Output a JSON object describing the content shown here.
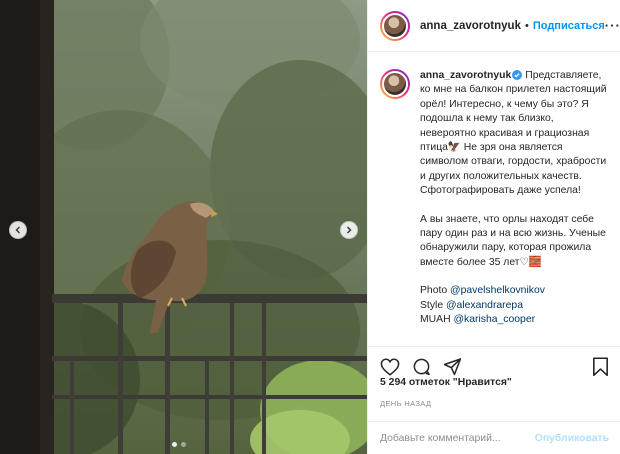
{
  "post": {
    "author": "anna_zavorotnyuk",
    "follow_label": "Подписаться",
    "separator": "•",
    "more_label": "···"
  },
  "caption": {
    "username": "anna_zavorotnyuk",
    "paragraph1": "Представляете, ко мне на балкон прилетел настоящий орёл! Интересно, к чему бы это? Я подошла к нему так близко, невероятно красивая и грациозная птица🦅 Не зря она является символом отваги, гордости, храбрости и других положительных качеств. Сфотографировать даже успела!",
    "paragraph2": "А вы знаете, что орлы находят себе пару один раз и на всю жизнь. Ученые обнаружили пару, которая прожила вместе более 35 лет♡🧱",
    "credits": [
      {
        "label": "Photo",
        "handle": "@pavelshelkovnikov"
      },
      {
        "label": "Style",
        "handle": "@alexandrarepa"
      },
      {
        "label": "MUAH",
        "handle": "@karisha_cooper"
      }
    ]
  },
  "stats": {
    "likes": "5 294 отметок \"Нравится\"",
    "timestamp": "День назад"
  },
  "comment": {
    "placeholder": "Добавьте комментарий...",
    "post_label": "Опубликовать"
  },
  "carousel": {
    "slides_total": 2,
    "active_slide": 1
  },
  "colors": {
    "accent": "#0095f6",
    "verified": "#3897f0",
    "link": "#00376b",
    "post_disabled": "#b2dffc"
  },
  "icons": [
    "heart-icon",
    "comment-icon",
    "share-icon",
    "bookmark-icon",
    "chevron-left-icon",
    "chevron-right-icon",
    "verified-badge-icon"
  ]
}
